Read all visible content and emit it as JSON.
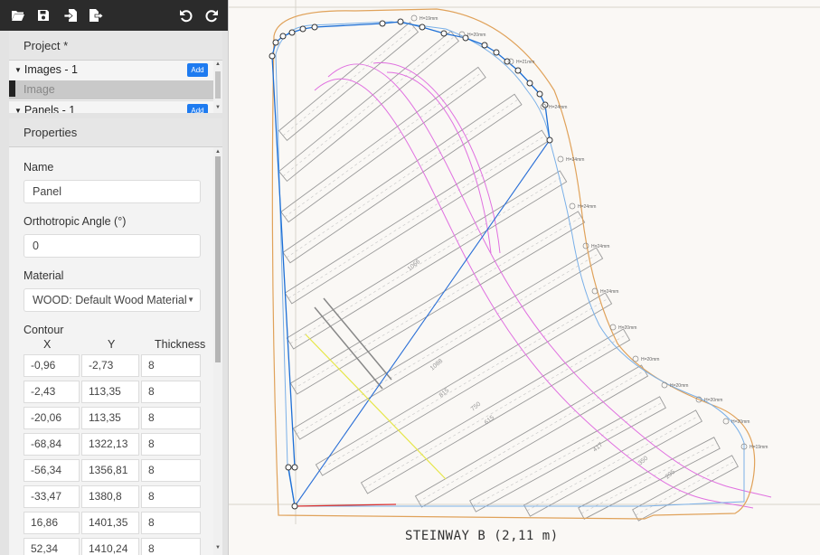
{
  "toolbar": {
    "icons": [
      "open-folder-icon",
      "save-icon",
      "import-icon",
      "export-icon",
      "undo-icon",
      "redo-icon"
    ]
  },
  "project": {
    "title": "Project *"
  },
  "tree": {
    "images": {
      "label": "Images - 1",
      "add_label": "Add"
    },
    "image_item": "Image",
    "panels": {
      "label": "Panels - 1",
      "add_label": "Add"
    }
  },
  "properties": {
    "title": "Properties",
    "name_label": "Name",
    "name_value": "Panel",
    "angle_label": "Orthotropic Angle (°)",
    "angle_value": "0",
    "material_label": "Material",
    "material_value": "WOOD: Default Wood Material",
    "contour_label": "Contour",
    "columns": [
      "X",
      "Y",
      "Thickness"
    ],
    "rows": [
      [
        "-0,96",
        "-2,73",
        "8"
      ],
      [
        "-2,43",
        "113,35",
        "8"
      ],
      [
        "-20,06",
        "113,35",
        "8"
      ],
      [
        "-68,84",
        "1322,13",
        "8"
      ],
      [
        "-56,34",
        "1356,81",
        "8"
      ],
      [
        "-33,47",
        "1380,8",
        "8"
      ],
      [
        "16,86",
        "1401,35",
        "8"
      ],
      [
        "52,34",
        "1410,24",
        "8"
      ]
    ]
  },
  "drawing": {
    "caption": "STEINWAY B (2,11 m)",
    "rib_heights": [
      "H=19mm",
      "H=20mm",
      "H=21mm",
      "H=24mm",
      "H=24mm",
      "H=24mm",
      "H=24mm",
      "H=24mm",
      "H=20mm",
      "H=20mm",
      "H=20mm",
      "H=20mm",
      "H=20mm",
      "H=19mm"
    ],
    "rib_lengths": [
      "1066",
      "1088",
      "815",
      "750",
      "615",
      "417",
      "350",
      "295"
    ],
    "colors": {
      "contour": "#1d6fd6",
      "outer_outline": "#e0a25a",
      "ribs": "#9a9a9a",
      "bridge": "#e070e0",
      "diagonal": "#2a6fd6",
      "yellow_line": "#e6e64a",
      "red_line": "#d93030"
    }
  }
}
